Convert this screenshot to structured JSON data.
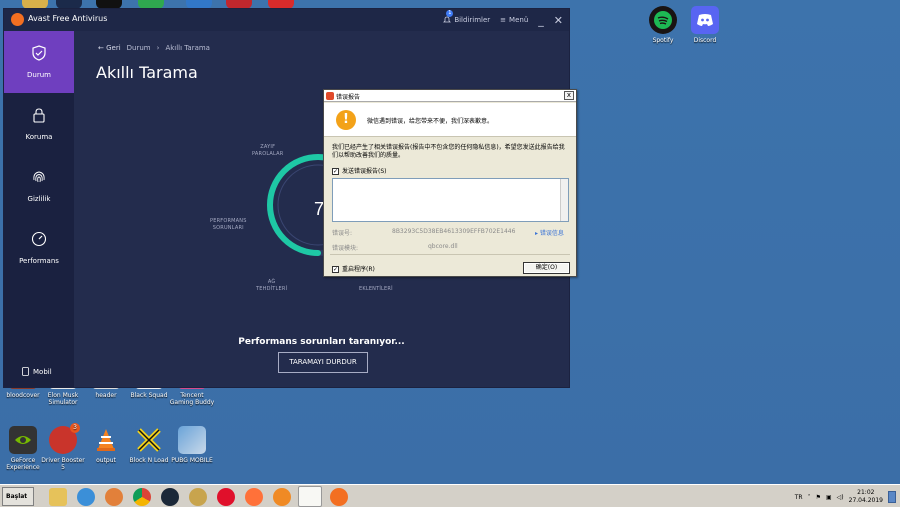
{
  "avast": {
    "title": "Avast Free Antivirus",
    "notifications": "Bildirimler",
    "notification_count": "1",
    "menu": "Menü",
    "minimize": "_",
    "close": "✕",
    "sidebar": [
      {
        "label": "Durum",
        "icon": "shield-check-icon",
        "active": true
      },
      {
        "label": "Koruma",
        "icon": "lock-icon",
        "active": false
      },
      {
        "label": "Gizlilik",
        "icon": "fingerprint-icon",
        "active": false
      },
      {
        "label": "Performans",
        "icon": "speedometer-icon",
        "active": false
      }
    ],
    "mobile": "Mobil",
    "breadcrumb": {
      "back": "Geri",
      "parent": "Durum",
      "current": "Akıllı Tarama"
    },
    "page_title": "Akıllı Tarama",
    "scan_labels": {
      "weak_passwords": [
        "ZAYIF",
        "PAROLALAR"
      ],
      "performance_issues": [
        "PERFORMANS",
        "SORUNLARI"
      ],
      "network_threats": [
        "AĞ",
        "TEHDİTLERİ"
      ],
      "extensions": "EKLENTİLERİ"
    },
    "gauge_value": "77",
    "progress_fraction": 0.77,
    "progress_text": "Performans sorunları taranıyor...",
    "stop_button": "TARAMAYI DURDUR"
  },
  "dialog": {
    "title": "错误报告",
    "close": "x",
    "message": "微信遇到错误，给您带来不便，我们深表歉意。",
    "body": "我们已经产生了相关错误报告(报告中不包含您的任何隐私信息)，希望您发送此报告给我们以帮助改善我们的质量。",
    "send_report_label": "发送错误报告(S)",
    "send_report_checked": true,
    "error_id_label": "错误号:",
    "error_id_value": "8B3293C5D38EB4613309EFFB702E1446",
    "error_info_link": "错误信息",
    "error_module_label": "错误模块:",
    "error_module_value": "qbcore.dll",
    "restart_label": "重启程序(R)",
    "restart_checked": true,
    "ok_button": "确定(O)"
  },
  "desktop": {
    "top_right_icons": [
      {
        "label": "Spotify",
        "icon": "spotify-icon",
        "color": "#1db954"
      },
      {
        "label": "Discord",
        "icon": "discord-icon",
        "color": "#5865f2"
      }
    ],
    "row1": [
      {
        "label": "bloodcover",
        "icon": "image-icon"
      },
      {
        "label": "Elon Musk Simulator",
        "icon": "game-icon"
      },
      {
        "label": "header",
        "icon": "image-icon"
      },
      {
        "label": "Black Squad",
        "icon": "game-icon"
      },
      {
        "label": "Tencent Gaming Buddy",
        "icon": "tencent-icon"
      }
    ],
    "row2": [
      {
        "label": "GeForce Experience",
        "icon": "nvidia-icon"
      },
      {
        "label": "Driver Booster 5",
        "icon": "driver-booster-icon",
        "badge": "3"
      },
      {
        "label": "output",
        "icon": "vlc-icon"
      },
      {
        "label": "Block N Load",
        "icon": "block-n-load-icon"
      },
      {
        "label": "PUBG MOBILE",
        "icon": "pubg-icon"
      }
    ]
  },
  "taskbar": {
    "start": "Başlat",
    "language": "TR",
    "time": "21:02",
    "date": "27.04.2019"
  },
  "colors": {
    "avast_sidebar_active": "#6f3fbf",
    "avast_bg": "#232c4d",
    "gauge_arc": "#1ec8a5",
    "desktop_bg": "#3a6ea5"
  }
}
